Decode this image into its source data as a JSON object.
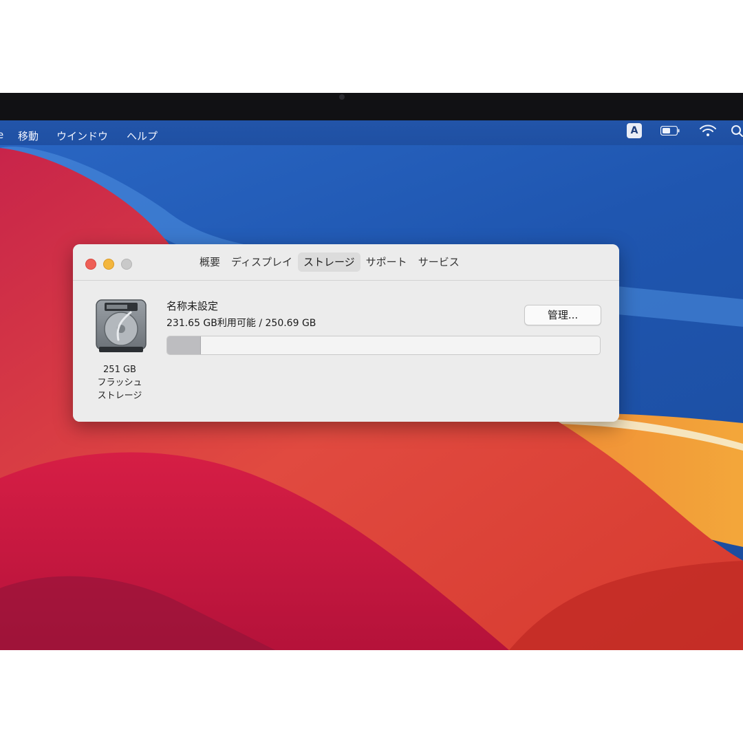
{
  "menubar": {
    "items": [
      "移動",
      "ウインドウ",
      "ヘルプ"
    ],
    "input_indicator": "A",
    "icons": [
      "battery-icon",
      "wifi-icon",
      "search-icon"
    ]
  },
  "window": {
    "tabs": [
      {
        "label": "概要",
        "active": false
      },
      {
        "label": "ディスプレイ",
        "active": false
      },
      {
        "label": "ストレージ",
        "active": true
      },
      {
        "label": "サポート",
        "active": false
      },
      {
        "label": "サービス",
        "active": false
      }
    ],
    "drive": {
      "icon": "hard-drive-icon",
      "size_label": "251 GB",
      "type_line1": "フラッシュ",
      "type_line2": "ストレージ"
    },
    "volume": {
      "name": "名称未設定",
      "capacity_text": "231.65 GB利用可能 / 250.69 GB",
      "used_fraction": 0.076
    },
    "manage_button_label": "管理..."
  },
  "colors": {
    "close": "#ee5f57",
    "minimize": "#f3b63e",
    "zoom_inactive": "#c9c9c9",
    "storage_used": "#bdbdc0"
  }
}
